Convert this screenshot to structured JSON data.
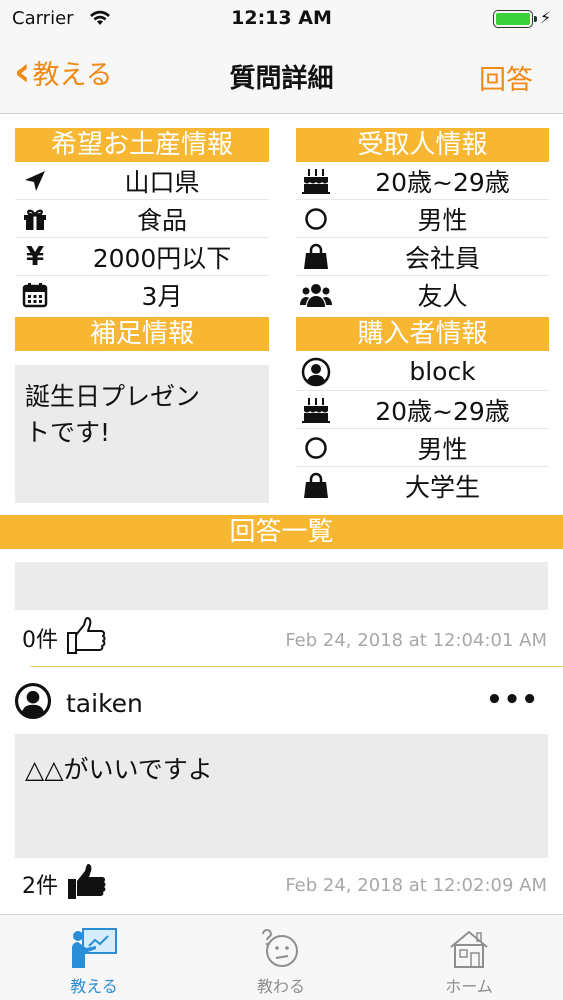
{
  "status_bar": {
    "carrier": "Carrier",
    "time": "12:13 AM",
    "battery_level": 1.0
  },
  "nav": {
    "back_label": "教える",
    "title": "質問詳細",
    "action_label": "回答"
  },
  "gift_info": {
    "header": "希望お土産情報",
    "rows": [
      {
        "icon": "location-arrow-icon",
        "value": "山口県"
      },
      {
        "icon": "gift-icon",
        "value": "食品"
      },
      {
        "icon": "yen-icon",
        "value": "2000円以下"
      },
      {
        "icon": "calendar-icon",
        "value": "3月"
      }
    ]
  },
  "recipient_info": {
    "header": "受取人情報",
    "rows": [
      {
        "icon": "birthday-cake-icon",
        "value": "20歳~29歳"
      },
      {
        "icon": "circle-icon",
        "value": "男性"
      },
      {
        "icon": "shopping-bag-icon",
        "value": "会社員"
      },
      {
        "icon": "group-icon",
        "value": "友人"
      }
    ]
  },
  "supplement": {
    "header": "補足情報",
    "text_line1": "誕生日プレゼン",
    "text_line2": "トです!"
  },
  "buyer_info": {
    "header": "購入者情報",
    "rows": [
      {
        "icon": "user-icon",
        "value": "block"
      },
      {
        "icon": "birthday-cake-icon",
        "value": "20歳~29歳"
      },
      {
        "icon": "circle-icon",
        "value": "男性"
      },
      {
        "icon": "shopping-bag-icon",
        "value": "大学生"
      }
    ]
  },
  "answers": {
    "header": "回答一覧",
    "items": [
      {
        "user": "",
        "text": "",
        "likes": "0件",
        "liked": false,
        "timestamp": "Feb 24, 2018 at 12:04:01 AM"
      },
      {
        "user": "taiken",
        "text": "△△がいいですよ",
        "likes": "2件",
        "liked": true,
        "timestamp": "Feb 24, 2018 at 12:02:09 AM",
        "more": "•••"
      }
    ]
  },
  "tabs": [
    {
      "label": "教える",
      "icon": "teacher-icon",
      "active": true
    },
    {
      "label": "教わる",
      "icon": "confused-face-icon",
      "active": false
    },
    {
      "label": "ホーム",
      "icon": "house-icon",
      "active": false
    }
  ],
  "colors": {
    "accent": "#f08a14",
    "section": "#f7b733",
    "tab_active": "#2a8ed6",
    "tab_inactive": "#8e8e8e"
  }
}
